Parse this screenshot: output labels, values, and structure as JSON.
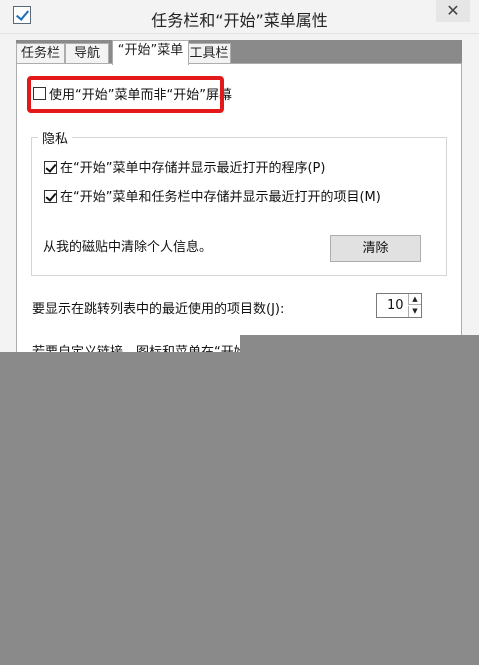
{
  "window": {
    "title": "任务栏和“开始”菜单属性",
    "close_label": "✕"
  },
  "tabs": [
    {
      "label": "任务栏"
    },
    {
      "label": "导航"
    },
    {
      "label": "“开始”菜单"
    },
    {
      "label": "工具栏"
    }
  ],
  "start_menu": {
    "use_start_menu_label": "使用“开始”菜单而非“开始”屏幕",
    "privacy_title": "隐私",
    "store_programs_label": "在“开始”菜单中存储并显示最近打开的程序(P)",
    "store_items_label": "在“开始”菜单和任务栏中存储并显示最近打开的项目(M)",
    "clear_tiles_text": "从我的磁贴中清除个人信息。",
    "clear_button": "清除",
    "jump_list_label": "要显示在跳转列表中的最近使用的项目数(J):",
    "jump_list_value": "10",
    "cutoff_text": "若要自定义链接、图标和菜单在“开始"
  }
}
